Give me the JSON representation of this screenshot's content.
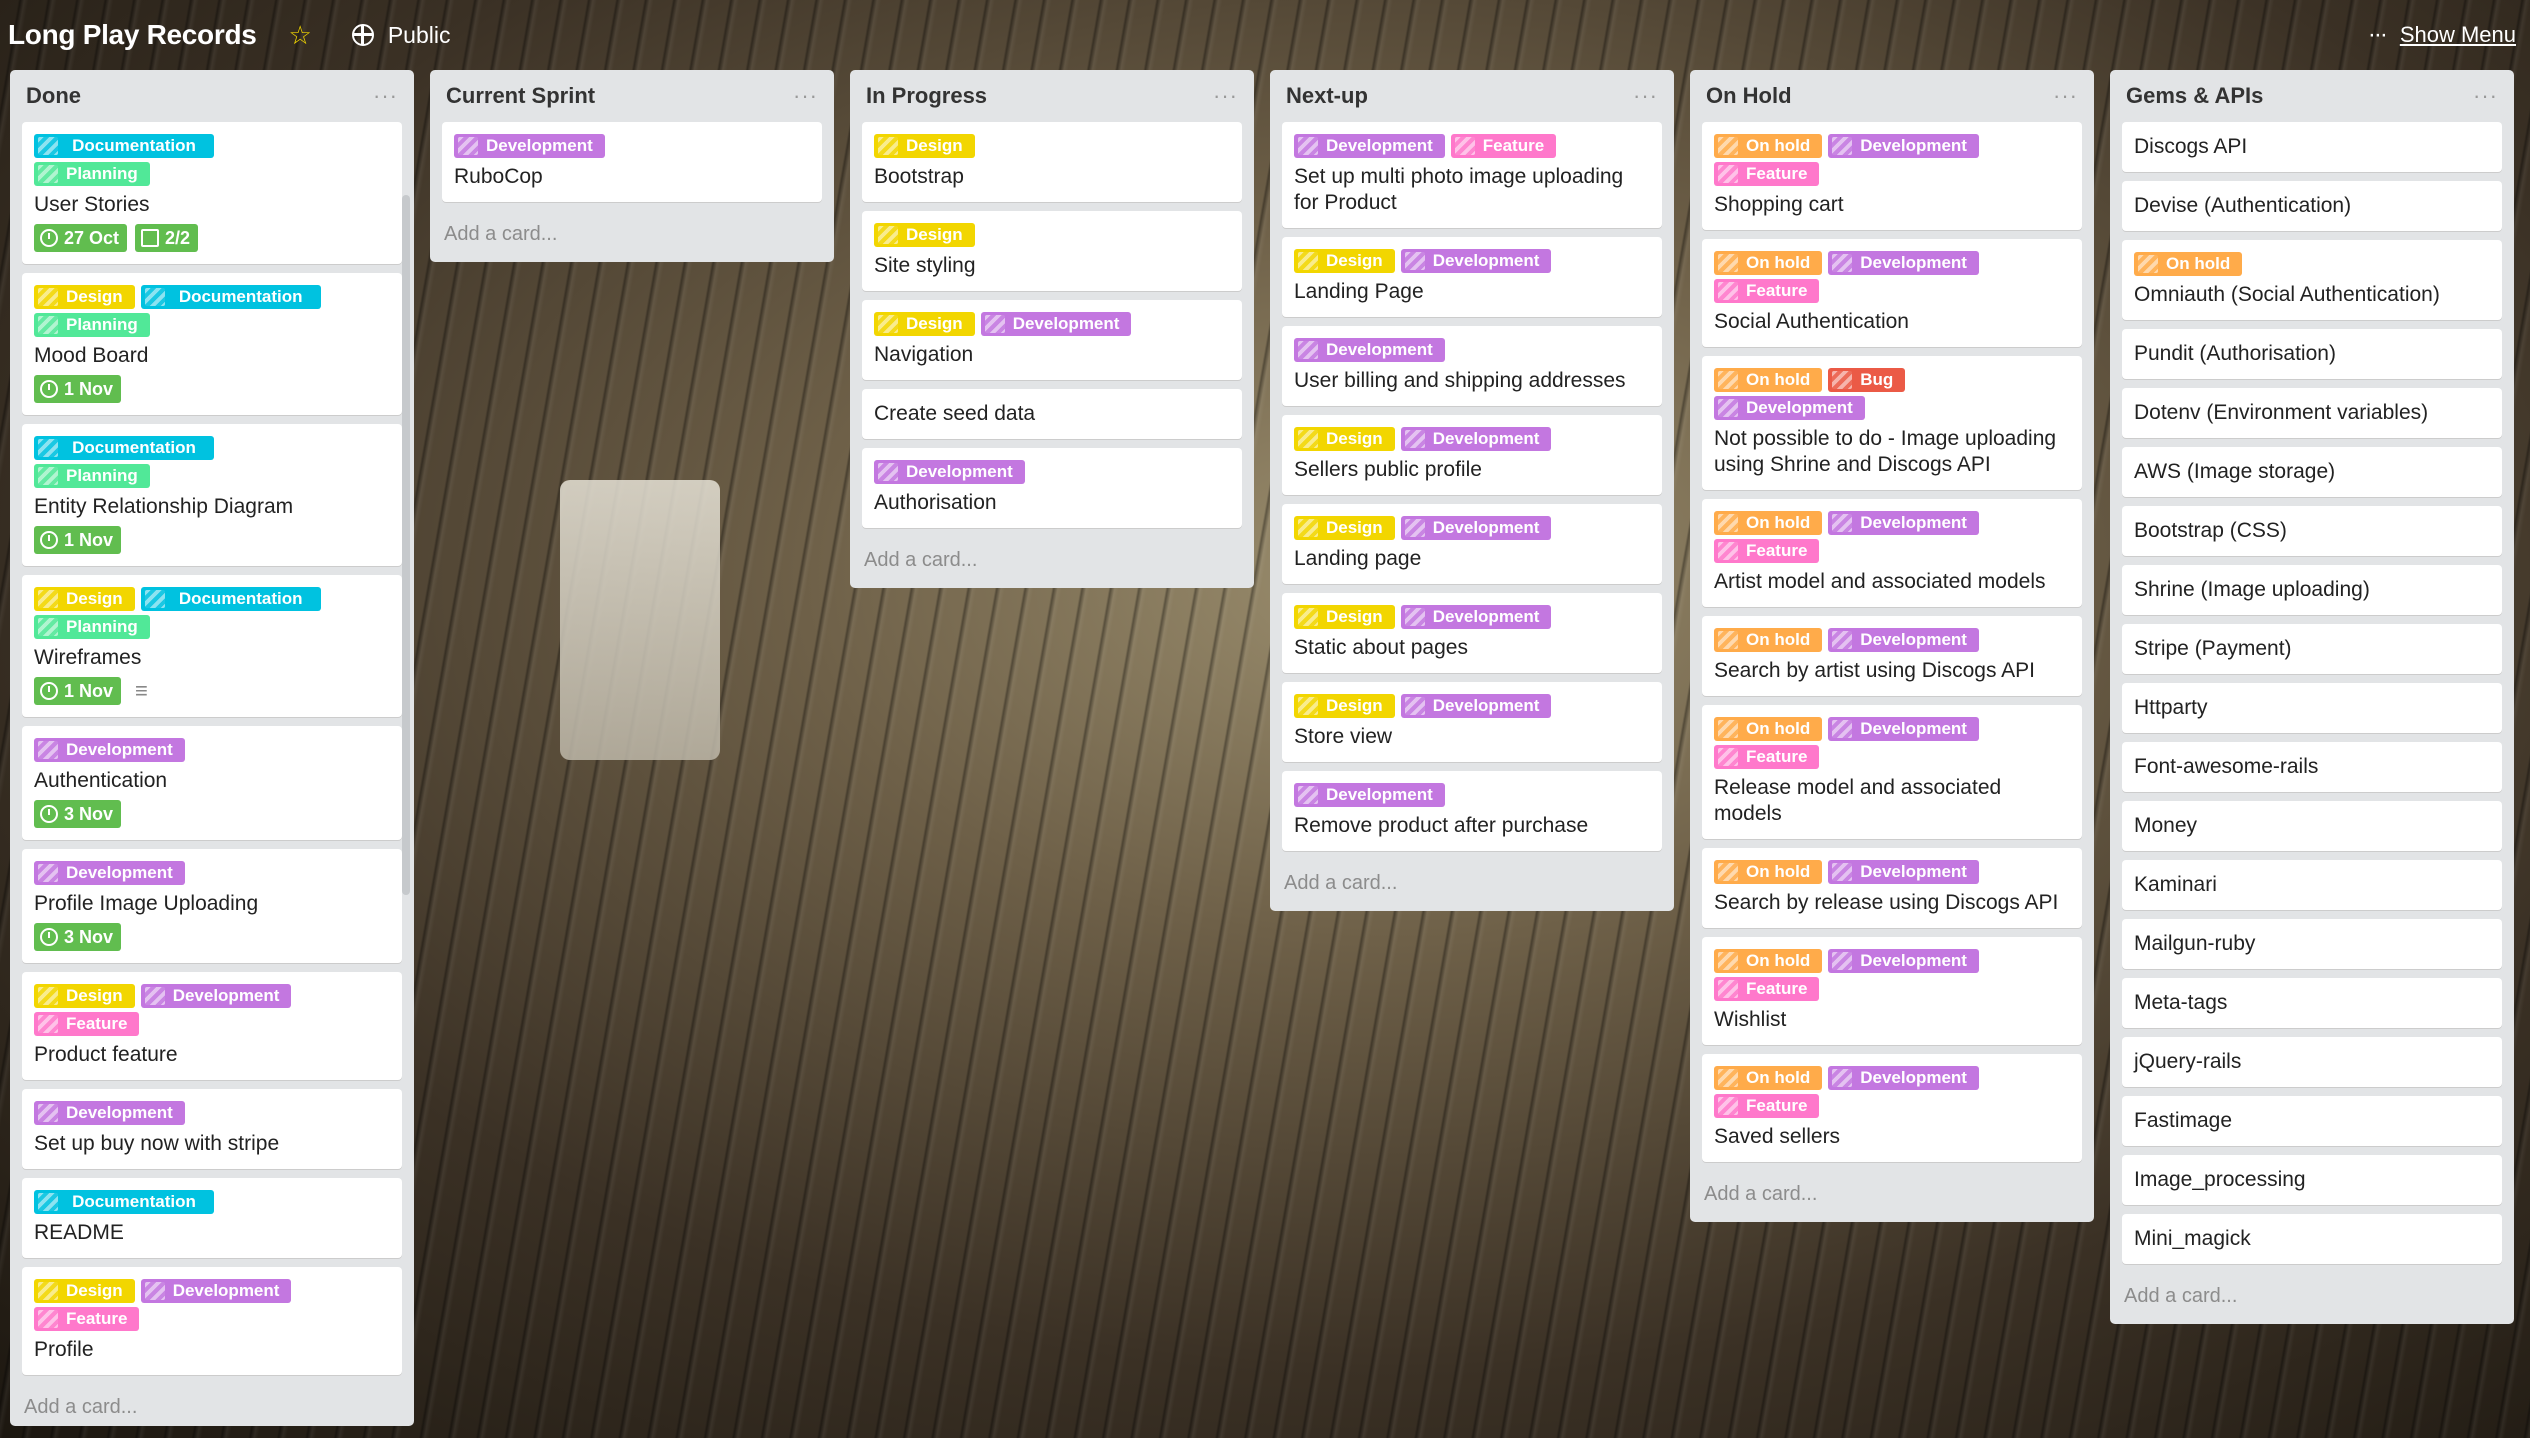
{
  "board": {
    "title": "Long Play Records",
    "visibility": "Public",
    "show_menu": "Show Menu",
    "star_icon": "star-icon",
    "globe_icon": "globe-icon"
  },
  "colors": {
    "Documentation": "#00c2e0",
    "Planning": "#51e898",
    "Design": "#f2d600",
    "Development": "#c377e0",
    "Feature": "#ff78cb",
    "On hold": "#ffab4a",
    "Bug": "#eb5a46",
    "badge_green": "#61bd4f"
  },
  "add_card": "Add a card...",
  "lists": [
    {
      "title": "Done",
      "cards": [
        {
          "labels": [
            "Documentation",
            "Planning"
          ],
          "title": "User Stories",
          "due": "27 Oct",
          "checklist": "2/2"
        },
        {
          "labels": [
            "Design",
            "Documentation",
            "Planning"
          ],
          "title": "Mood Board",
          "due": "1 Nov"
        },
        {
          "labels": [
            "Documentation",
            "Planning"
          ],
          "title": "Entity Relationship Diagram",
          "due": "1 Nov"
        },
        {
          "labels": [
            "Design",
            "Documentation",
            "Planning"
          ],
          "title": "Wireframes",
          "due": "1 Nov",
          "description": true
        },
        {
          "labels": [
            "Development"
          ],
          "title": "Authentication",
          "due": "3 Nov"
        },
        {
          "labels": [
            "Development"
          ],
          "title": "Profile Image Uploading",
          "due": "3 Nov"
        },
        {
          "labels": [
            "Design",
            "Development",
            "Feature"
          ],
          "title": "Product feature"
        },
        {
          "labels": [
            "Development"
          ],
          "title": "Set up buy now with stripe"
        },
        {
          "labels": [
            "Documentation"
          ],
          "title": "README"
        },
        {
          "labels": [
            "Design",
            "Development",
            "Feature"
          ],
          "title": "Profile"
        }
      ]
    },
    {
      "title": "Current Sprint",
      "cards": [
        {
          "labels": [
            "Development"
          ],
          "title": "RuboCop"
        }
      ]
    },
    {
      "title": "In Progress",
      "cards": [
        {
          "labels": [
            "Design"
          ],
          "title": "Bootstrap"
        },
        {
          "labels": [
            "Design"
          ],
          "title": "Site styling"
        },
        {
          "labels": [
            "Design",
            "Development"
          ],
          "title": "Navigation"
        },
        {
          "labels": [],
          "title": "Create seed data"
        },
        {
          "labels": [
            "Development"
          ],
          "title": "Authorisation"
        }
      ]
    },
    {
      "title": "Next-up",
      "cards": [
        {
          "labels": [
            "Development",
            "Feature"
          ],
          "title": "Set up multi photo image uploading for Product"
        },
        {
          "labels": [
            "Design",
            "Development"
          ],
          "title": "Landing Page"
        },
        {
          "labels": [
            "Development"
          ],
          "title": "User billing and shipping addresses"
        },
        {
          "labels": [
            "Design",
            "Development"
          ],
          "title": "Sellers public profile"
        },
        {
          "labels": [
            "Design",
            "Development"
          ],
          "title": "Landing page"
        },
        {
          "labels": [
            "Design",
            "Development"
          ],
          "title": "Static about pages"
        },
        {
          "labels": [
            "Design",
            "Development"
          ],
          "title": "Store view"
        },
        {
          "labels": [
            "Development"
          ],
          "title": "Remove product after purchase"
        }
      ]
    },
    {
      "title": "On Hold",
      "cards": [
        {
          "labels": [
            "On hold",
            "Development",
            "Feature"
          ],
          "title": "Shopping cart"
        },
        {
          "labels": [
            "On hold",
            "Development",
            "Feature"
          ],
          "title": "Social Authentication"
        },
        {
          "labels": [
            "On hold",
            "Bug",
            "Development"
          ],
          "title": "Not possible to do - Image uploading using Shrine and Discogs API"
        },
        {
          "labels": [
            "On hold",
            "Development",
            "Feature"
          ],
          "title": "Artist model and associated models"
        },
        {
          "labels": [
            "On hold",
            "Development"
          ],
          "title": "Search by artist using Discogs API"
        },
        {
          "labels": [
            "On hold",
            "Development",
            "Feature"
          ],
          "title": "Release model and associated models"
        },
        {
          "labels": [
            "On hold",
            "Development"
          ],
          "title": "Search by release using Discogs API"
        },
        {
          "labels": [
            "On hold",
            "Development",
            "Feature"
          ],
          "title": "Wishlist"
        },
        {
          "labels": [
            "On hold",
            "Development",
            "Feature"
          ],
          "title": "Saved sellers"
        }
      ]
    },
    {
      "title": "Gems & APIs",
      "cards": [
        {
          "labels": [],
          "title": "Discogs API"
        },
        {
          "labels": [],
          "title": "Devise (Authentication)"
        },
        {
          "labels": [
            "On hold"
          ],
          "title": "Omniauth (Social Authentication)"
        },
        {
          "labels": [],
          "title": "Pundit (Authorisation)"
        },
        {
          "labels": [],
          "title": "Dotenv (Environment variables)"
        },
        {
          "labels": [],
          "title": "AWS (Image storage)"
        },
        {
          "labels": [],
          "title": "Bootstrap (CSS)"
        },
        {
          "labels": [],
          "title": "Shrine (Image uploading)"
        },
        {
          "labels": [],
          "title": "Stripe (Payment)"
        },
        {
          "labels": [],
          "title": "Httparty"
        },
        {
          "labels": [],
          "title": "Font-awesome-rails"
        },
        {
          "labels": [],
          "title": "Money"
        },
        {
          "labels": [],
          "title": "Kaminari"
        },
        {
          "labels": [],
          "title": "Mailgun-ruby"
        },
        {
          "labels": [],
          "title": "Meta-tags"
        },
        {
          "labels": [],
          "title": "jQuery-rails"
        },
        {
          "labels": [],
          "title": "Fastimage"
        },
        {
          "labels": [],
          "title": "Image_processing"
        },
        {
          "labels": [],
          "title": "Mini_magick"
        }
      ]
    }
  ]
}
